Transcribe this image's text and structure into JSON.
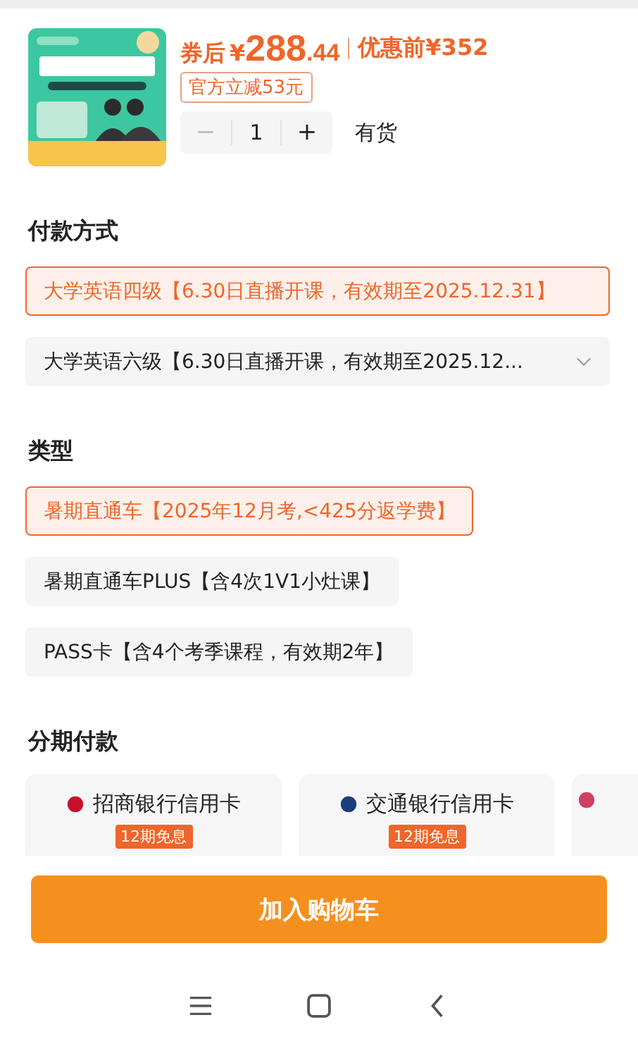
{
  "product": {
    "price_prefix": "券后",
    "currency": "¥",
    "price_int": "288",
    "price_dec": ".44",
    "original_label": "优惠前",
    "original_price": "¥352",
    "discount_tag": "官方立减53元",
    "quantity": {
      "minus": "−",
      "value": "1",
      "plus": "+",
      "minus_disabled": true
    },
    "stock": "有货"
  },
  "sections": [
    {
      "title": "付款方式",
      "options": [
        {
          "label": "大学英语四级【6.30日直播开课，有效期至2025.12.31】",
          "selected": true,
          "full": true,
          "dropdown": false
        },
        {
          "label": "大学英语六级【6.30日直播开课，有效期至2025.12...",
          "selected": false,
          "full": true,
          "dropdown": true
        }
      ]
    },
    {
      "title": "类型",
      "options": [
        {
          "label": "暑期直通车【2025年12月考,<425分返学费】",
          "selected": true,
          "full": false,
          "dropdown": false
        },
        {
          "label": "暑期直通车PLUS【含4次1V1小灶课】",
          "selected": false,
          "full": false,
          "dropdown": false
        },
        {
          "label": "PASS卡【含4个考季课程，有效期2年】",
          "selected": false,
          "full": false,
          "dropdown": false
        }
      ]
    }
  ],
  "installments": {
    "title": "分期付款",
    "cards": [
      {
        "name": "招商银行信用卡",
        "badge": "12期免息",
        "color": "#c8102e"
      },
      {
        "name": "交通银行信用卡",
        "badge": "12期免息",
        "color": "#1a3d7c"
      },
      {
        "color": "#d04060"
      }
    ]
  },
  "add_to_cart": "加入购物车"
}
